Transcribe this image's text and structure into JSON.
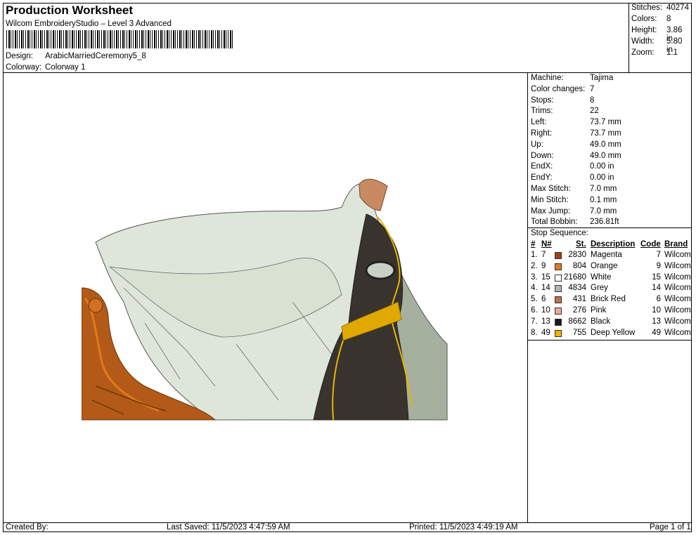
{
  "header": {
    "title": "Production Worksheet",
    "software": "Wilcom EmbroideryStudio – Level 3 Advanced",
    "design_label": "Design:",
    "design_value": "ArabicMarriedCeremony5_8",
    "colorway_label": "Colorway:",
    "colorway_value": "Colorway 1"
  },
  "top_right": [
    {
      "label": "Stitches:",
      "value": "40274"
    },
    {
      "label": "Colors:",
      "value": "8"
    },
    {
      "label": "Height:",
      "value": "3.86 in"
    },
    {
      "label": "Width:",
      "value": "5.80 in"
    },
    {
      "label": "Zoom:",
      "value": "1:1"
    }
  ],
  "machine_stats": [
    {
      "label": "Machine:",
      "value": "Tajima"
    },
    {
      "label": "Color changes:",
      "value": "7"
    },
    {
      "label": "Stops:",
      "value": "8"
    },
    {
      "label": "Trims:",
      "value": "22"
    },
    {
      "label": "Left:",
      "value": "73.7 mm"
    },
    {
      "label": "Right:",
      "value": "73.7 mm"
    },
    {
      "label": "Up:",
      "value": "49.0 mm"
    },
    {
      "label": "Down:",
      "value": "49.0 mm"
    },
    {
      "label": "EndX:",
      "value": "0.00 in"
    },
    {
      "label": "EndY:",
      "value": "0.00 in"
    },
    {
      "label": "Max Stitch:",
      "value": "7.0 mm"
    },
    {
      "label": "Min Stitch:",
      "value": "0.1 mm"
    },
    {
      "label": "Max Jump:",
      "value": "7.0 mm"
    },
    {
      "label": "Total Bobbin:",
      "value": "236.81ft"
    }
  ],
  "stop_sequence": {
    "title": "Stop Sequence:",
    "headers": {
      "num": "#",
      "needle": "N#",
      "stitches": "St.",
      "description": "Description",
      "code": "Code",
      "brand": "Brand"
    },
    "rows": [
      {
        "num": "1.",
        "needle": "7",
        "stitches": "2830",
        "description": "Magenta",
        "code": "7",
        "brand": "Wilcom",
        "color": "#a0401a"
      },
      {
        "num": "2.",
        "needle": "9",
        "stitches": "804",
        "description": "Orange",
        "code": "9",
        "brand": "Wilcom",
        "color": "#e07a1e"
      },
      {
        "num": "3.",
        "needle": "15",
        "stitches": "21680",
        "description": "White",
        "code": "15",
        "brand": "Wilcom",
        "color": "#ffffff"
      },
      {
        "num": "4.",
        "needle": "14",
        "stitches": "4834",
        "description": "Grey",
        "code": "14",
        "brand": "Wilcom",
        "color": "#b4b4b4"
      },
      {
        "num": "5.",
        "needle": "6",
        "stitches": "431",
        "description": "Brick Red",
        "code": "6",
        "brand": "Wilcom",
        "color": "#c0704c"
      },
      {
        "num": "6.",
        "needle": "10",
        "stitches": "276",
        "description": "Pink",
        "code": "10",
        "brand": "Wilcom",
        "color": "#f0a898"
      },
      {
        "num": "7.",
        "needle": "13",
        "stitches": "8662",
        "description": "Black",
        "code": "13",
        "brand": "Wilcom",
        "color": "#1a1a1a"
      },
      {
        "num": "8.",
        "needle": "49",
        "stitches": "755",
        "description": "Deep Yellow",
        "code": "49",
        "brand": "Wilcom",
        "color": "#f0b400"
      }
    ]
  },
  "footer": {
    "created_by": "Created By:",
    "last_saved": "Last Saved: 11/5/2023 4:47:59 AM",
    "printed": "Printed: 11/5/2023 4:49:19 AM",
    "page": "Page 1 of 1"
  }
}
